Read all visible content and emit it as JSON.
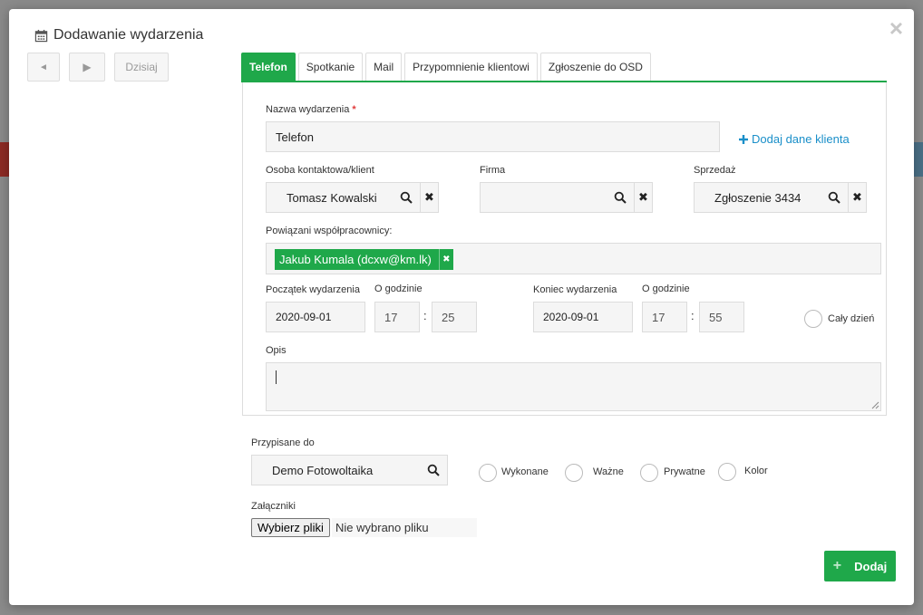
{
  "modal": {
    "title": "Dodawanie wydarzenia",
    "close_glyph": "×"
  },
  "nav": {
    "prev_glyph": "◄",
    "next_glyph": "▶",
    "today_label": "Dzisiaj"
  },
  "tabs": [
    {
      "label": "Telefon",
      "active": true
    },
    {
      "label": "Spotkanie"
    },
    {
      "label": "Mail"
    },
    {
      "label": "Przypomnienie klientowi"
    },
    {
      "label": "Zgłoszenie do OSD"
    }
  ],
  "form": {
    "event_name_label": "Nazwa wydarzenia",
    "required_mark": "*",
    "event_name_value": "Telefon",
    "add_client_data_label": "Dodaj dane klienta",
    "contact_label": "Osoba kontaktowa/klient",
    "contact_value": "Tomasz Kowalski",
    "company_label": "Firma",
    "company_value": "",
    "sale_label": "Sprzedaż",
    "sale_value": "Zgłoszenie 3434",
    "clear_glyph": "✖",
    "coworkers_label": "Powiązani współpracownicy:",
    "coworker_tag": "Jakub Kumala (dcxw@km.lk)",
    "tag_close_glyph": "✖",
    "start_label": "Początek wydarzenia",
    "start_date": "2020-09-01",
    "start_time_label": "O godzinie",
    "start_hour": "17",
    "start_minute": "25",
    "end_label": "Koniec wydarzenia",
    "end_date": "2020-09-01",
    "end_time_label": "O godzinie",
    "end_hour": "17",
    "end_minute": "55",
    "time_separator": ":",
    "all_day_label": "Cały dzień",
    "description_label": "Opis",
    "description_value": ""
  },
  "assigned": {
    "label": "Przypisane do",
    "value": "Demo Fotowoltaika",
    "options": [
      "Wykonane",
      "Ważne",
      "Prywatne",
      "Kolor"
    ]
  },
  "attachments": {
    "label": "Załączniki",
    "button_label": "Wybierz pliki",
    "status": "Nie wybrano pliku"
  },
  "submit": {
    "label": "Dodaj",
    "icon_glyph": "+"
  },
  "colors": {
    "accent": "#1fa84a",
    "link": "#1a8fc9",
    "required": "#e03a3a"
  }
}
